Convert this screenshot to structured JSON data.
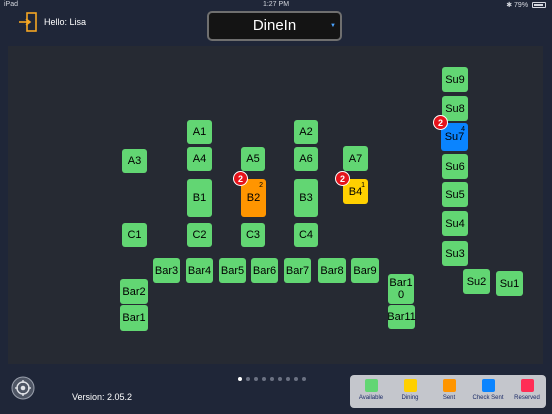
{
  "statusbar": {
    "carrier": "iPad",
    "time": "1:27 PM",
    "battery": "79%"
  },
  "header": {
    "greeting": "Hello: Lisa",
    "selector_value": "DineIn"
  },
  "colors": {
    "available": "#62d673",
    "dining": "#ffd000",
    "sent": "#ff9500",
    "check_sent": "#0a84ff",
    "reserved": "#ff2d55",
    "badge": "#e6131b"
  },
  "tables": [
    {
      "label": "A1",
      "status": "available"
    },
    {
      "label": "A2",
      "status": "available"
    },
    {
      "label": "A3",
      "status": "available"
    },
    {
      "label": "A4",
      "status": "available"
    },
    {
      "label": "A5",
      "status": "available"
    },
    {
      "label": "A6",
      "status": "available"
    },
    {
      "label": "A7",
      "status": "available"
    },
    {
      "label": "B1",
      "status": "available"
    },
    {
      "label": "B2",
      "status": "sent",
      "guests": "2",
      "badge": "2"
    },
    {
      "label": "B3",
      "status": "available"
    },
    {
      "label": "B4",
      "status": "dining",
      "guests": "1",
      "badge": "2"
    },
    {
      "label": "C1",
      "status": "available"
    },
    {
      "label": "C2",
      "status": "available"
    },
    {
      "label": "C3",
      "status": "available"
    },
    {
      "label": "C4",
      "status": "available"
    },
    {
      "label": "Bar1\n0",
      "status": "available"
    },
    {
      "label": "Bar2",
      "status": "available"
    },
    {
      "label": "Bar1",
      "status": "available"
    },
    {
      "label": "Bar3",
      "status": "available"
    },
    {
      "label": "Bar4",
      "status": "available"
    },
    {
      "label": "Bar5",
      "status": "available"
    },
    {
      "label": "Bar6",
      "status": "available"
    },
    {
      "label": "Bar7",
      "status": "available"
    },
    {
      "label": "Bar8",
      "status": "available"
    },
    {
      "label": "Bar9",
      "status": "available"
    },
    {
      "label": "Bar11",
      "status": "available"
    },
    {
      "label": "Su9",
      "status": "available"
    },
    {
      "label": "Su8",
      "status": "available"
    },
    {
      "label": "Su7",
      "status": "check_sent",
      "guests": "4",
      "badge": "2"
    },
    {
      "label": "Su6",
      "status": "available"
    },
    {
      "label": "Su5",
      "status": "available"
    },
    {
      "label": "Su4",
      "status": "available"
    },
    {
      "label": "Su3",
      "status": "available"
    },
    {
      "label": "Su2",
      "status": "available"
    },
    {
      "label": "Su1",
      "status": "available"
    }
  ],
  "footer": {
    "version": "Version: 2.05.2",
    "page_count": 9,
    "current_page": 1
  },
  "legend": [
    {
      "label": "Available",
      "color": "#62d673"
    },
    {
      "label": "Dining",
      "color": "#ffd000"
    },
    {
      "label": "Sent",
      "color": "#ff9500"
    },
    {
      "label": "Check Sent",
      "color": "#0a84ff"
    },
    {
      "label": "Reserved",
      "color": "#ff2d55"
    }
  ]
}
